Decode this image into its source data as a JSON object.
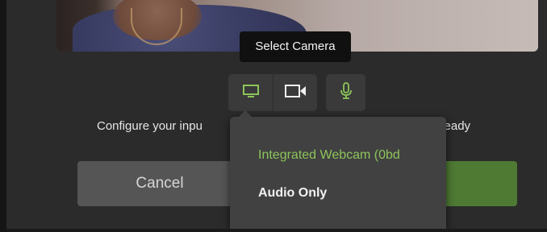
{
  "tooltip": {
    "text": "Select Camera"
  },
  "toolbar": {
    "screen_icon": "monitor-icon",
    "camera_icon": "video-camera-icon",
    "mic_icon": "microphone-icon"
  },
  "instructions": {
    "head": "Configure your inpu",
    "tail": "n ready"
  },
  "buttons": {
    "cancel_label": "Cancel"
  },
  "camera_menu": {
    "items": [
      {
        "label": "Integrated Webcam (0bd",
        "selected": true
      },
      {
        "label": "Audio Only",
        "selected": false
      }
    ]
  },
  "colors": {
    "accent_green": "#8dc45a",
    "button_green": "#4e7a34"
  }
}
